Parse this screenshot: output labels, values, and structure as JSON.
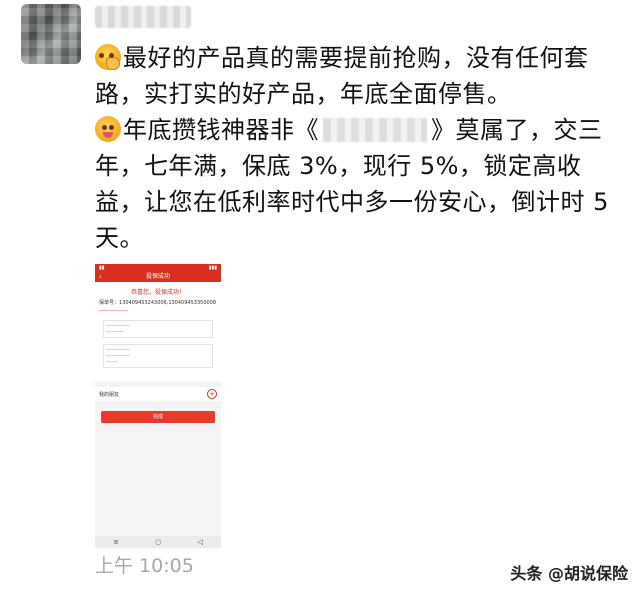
{
  "post": {
    "line1": "最好的产品真的需要提前抢购，没有任何套路，实打实的好产品，年底全面停售。",
    "line2_before": "年底攒钱神器非《",
    "line2_after": "》莫属了，交三年，七年满，保底 3%，现行 5%，锁定高收益，让您在低利率时代中多一份安心，倒计时 5 天。"
  },
  "emojis": [
    "hand-over-mouth-emoji-icon",
    "tongue-out-emoji-icon"
  ],
  "screenshot": {
    "title": "投保成功",
    "success_text": "恭喜您，投保成功！",
    "policy_label": "保单号：",
    "policy_numbers": "130409453243006,130409453350008",
    "friends_label": "我的朋友",
    "done_button": "完成"
  },
  "time": "上午 10:05",
  "watermark": "头条 @胡说保险",
  "colors": {
    "accent_red": "#d8301f",
    "timestamp_gray": "#a8a8a8"
  }
}
